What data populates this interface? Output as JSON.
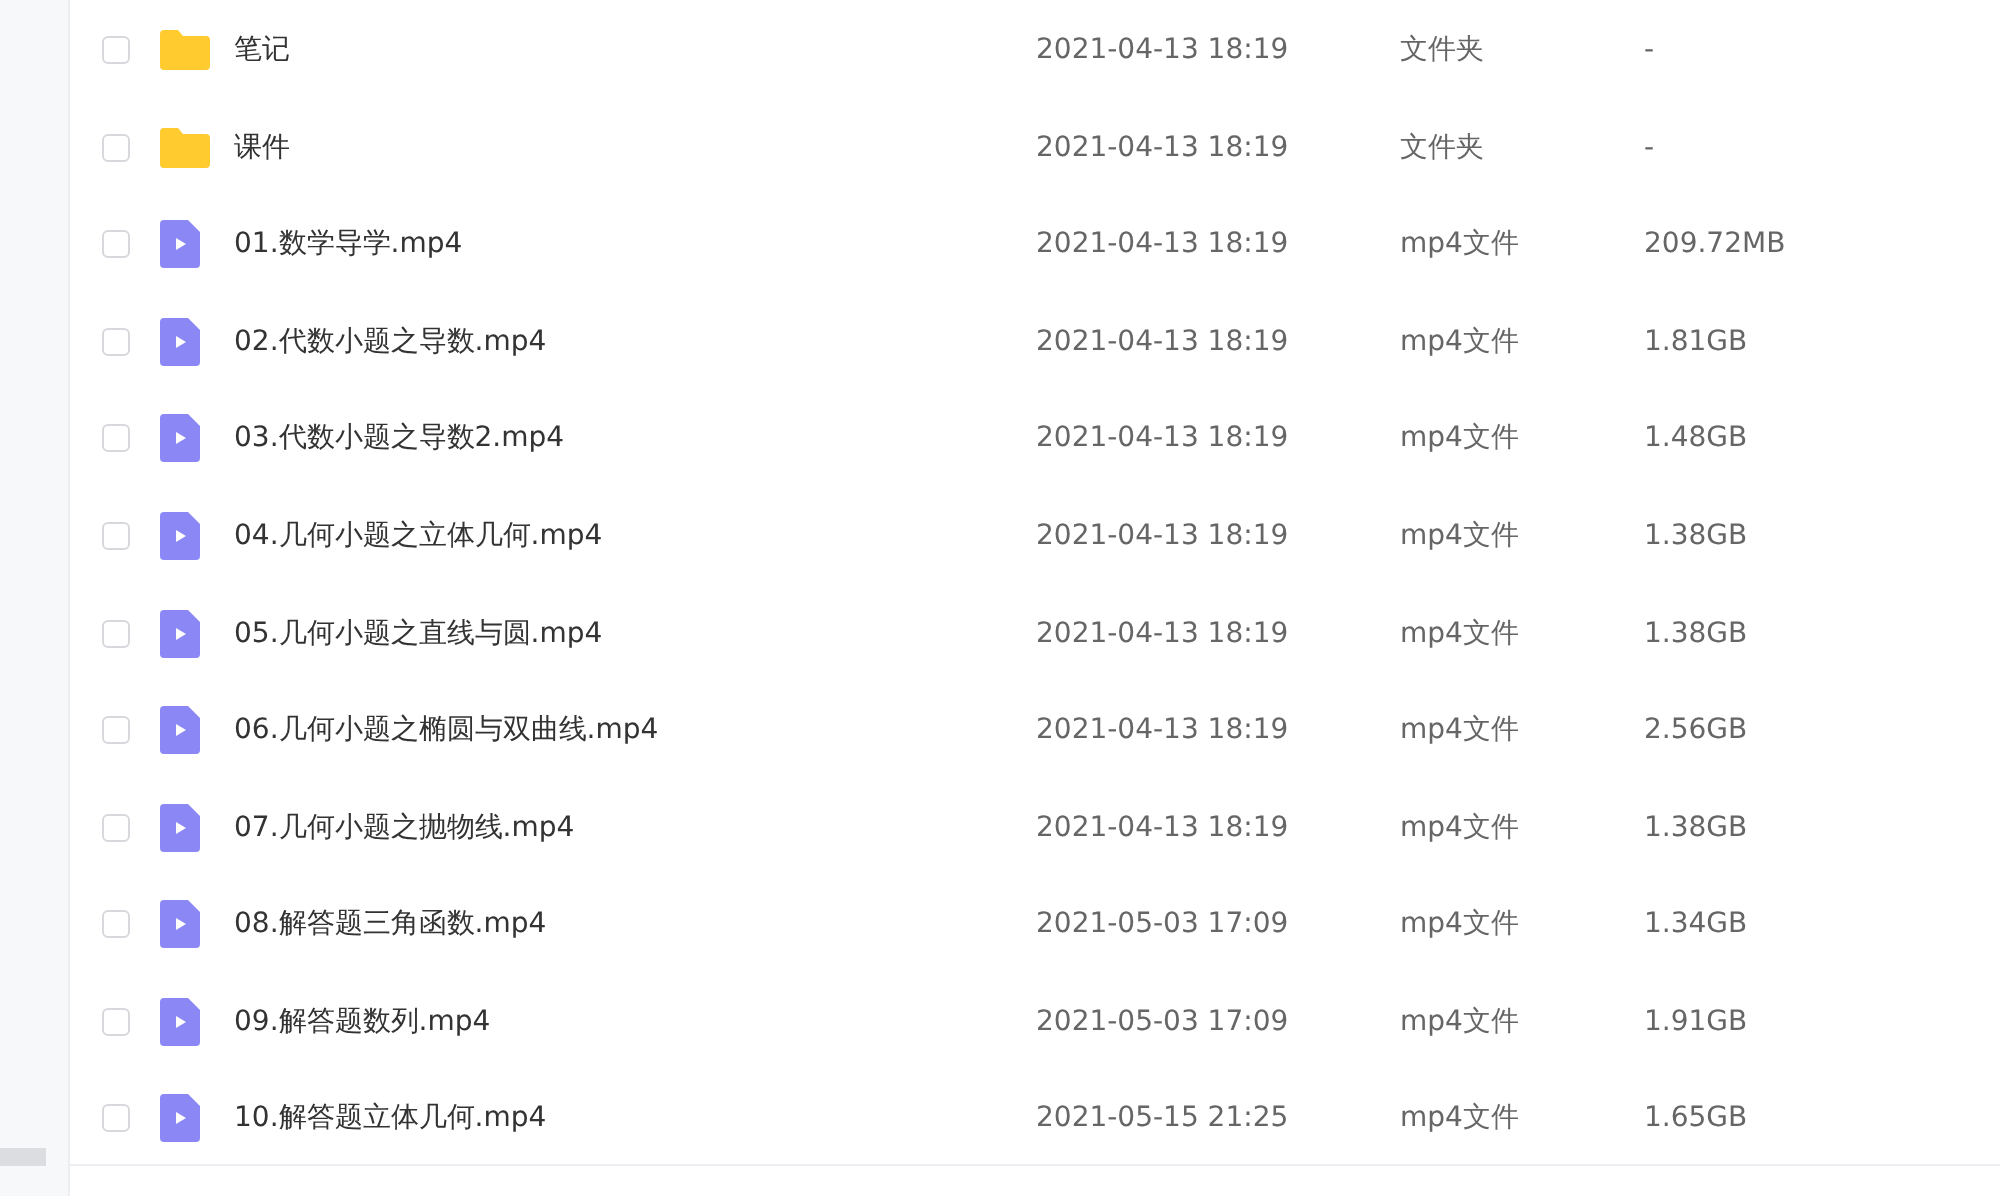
{
  "files": [
    {
      "kind": "folder",
      "name": "笔记",
      "date": "2021-04-13 18:19",
      "type": "文件夹",
      "size": "-",
      "checked": false
    },
    {
      "kind": "folder",
      "name": "课件",
      "date": "2021-04-13 18:19",
      "type": "文件夹",
      "size": "-",
      "checked": false
    },
    {
      "kind": "video",
      "name": "01.数学导学.mp4",
      "date": "2021-04-13 18:19",
      "type": "mp4文件",
      "size": "209.72MB",
      "checked": false
    },
    {
      "kind": "video",
      "name": "02.代数小题之导数.mp4",
      "date": "2021-04-13 18:19",
      "type": "mp4文件",
      "size": "1.81GB",
      "checked": false
    },
    {
      "kind": "video",
      "name": "03.代数小题之导数2.mp4",
      "date": "2021-04-13 18:19",
      "type": "mp4文件",
      "size": "1.48GB",
      "checked": false
    },
    {
      "kind": "video",
      "name": "04.几何小题之立体几何.mp4",
      "date": "2021-04-13 18:19",
      "type": "mp4文件",
      "size": "1.38GB",
      "checked": false
    },
    {
      "kind": "video",
      "name": "05.几何小题之直线与圆.mp4",
      "date": "2021-04-13 18:19",
      "type": "mp4文件",
      "size": "1.38GB",
      "checked": false
    },
    {
      "kind": "video",
      "name": "06.几何小题之椭圆与双曲线.mp4",
      "date": "2021-04-13 18:19",
      "type": "mp4文件",
      "size": "2.56GB",
      "checked": false
    },
    {
      "kind": "video",
      "name": "07.几何小题之抛物线.mp4",
      "date": "2021-04-13 18:19",
      "type": "mp4文件",
      "size": "1.38GB",
      "checked": false
    },
    {
      "kind": "video",
      "name": "08.解答题三角函数.mp4",
      "date": "2021-05-03 17:09",
      "type": "mp4文件",
      "size": "1.34GB",
      "checked": false
    },
    {
      "kind": "video",
      "name": "09.解答题数列.mp4",
      "date": "2021-05-03 17:09",
      "type": "mp4文件",
      "size": "1.91GB",
      "checked": false
    },
    {
      "kind": "video",
      "name": "10.解答题立体几何.mp4",
      "date": "2021-05-15 21:25",
      "type": "mp4文件",
      "size": "1.65GB",
      "checked": false
    }
  ]
}
